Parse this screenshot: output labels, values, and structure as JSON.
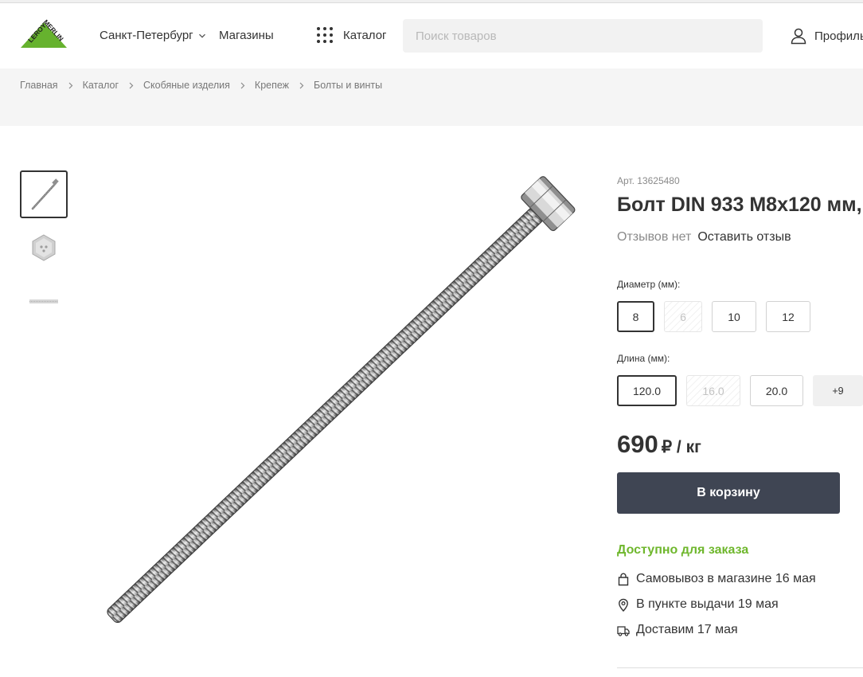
{
  "header": {
    "logo_top": "LEROY",
    "logo_bottom": "MERLIN",
    "city": "Санкт-Петербург",
    "stores": "Магазины",
    "catalog": "Каталог",
    "search_placeholder": "Поиск товаров",
    "profile": "Профиль"
  },
  "breadcrumb": [
    "Главная",
    "Каталог",
    "Скобяные изделия",
    "Крепеж",
    "Болты и винты"
  ],
  "gallery": {
    "thumbnails": [
      "bolt-side-view",
      "bolt-head-view",
      "bolt-thread-view"
    ],
    "active_index": 0
  },
  "product": {
    "article": "Арт. 13625480",
    "title": "Болт DIN 933 M8x120 мм,",
    "reviews_none": "Отзывов нет",
    "leave_review": "Оставить отзыв",
    "diameter_label": "Диаметр (мм):",
    "diameter_options": [
      {
        "value": "8",
        "state": "selected"
      },
      {
        "value": "6",
        "state": "disabled"
      },
      {
        "value": "10",
        "state": "normal"
      },
      {
        "value": "12",
        "state": "normal"
      }
    ],
    "length_label": "Длина (мм):",
    "length_options": [
      {
        "value": "120.0",
        "state": "selected"
      },
      {
        "value": "16.0",
        "state": "disabled"
      },
      {
        "value": "20.0",
        "state": "normal"
      }
    ],
    "length_more": "+9",
    "price": "690",
    "price_unit": "₽ / кг",
    "cart_button": "В корзину",
    "availability": "Доступно для заказа",
    "delivery": [
      {
        "icon": "bag-icon",
        "text": "Самовывоз в магазине 16 мая"
      },
      {
        "icon": "map-pin-icon",
        "text": "В пункте выдачи 19 мая"
      },
      {
        "icon": "truck-icon",
        "text": "Доставим 17 мая"
      }
    ]
  },
  "colors": {
    "brand_green": "#66b22e",
    "button_dark": "#3f4553",
    "availability_green": "#6fb72d"
  }
}
